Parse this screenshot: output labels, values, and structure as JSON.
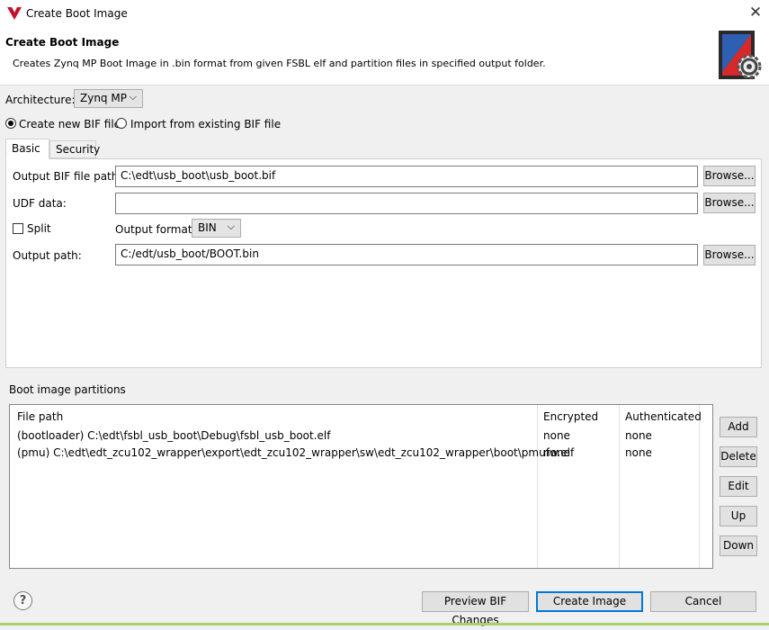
{
  "window": {
    "title": "Create Boot Image",
    "close_glyph": "✕"
  },
  "header": {
    "title": "Create Boot Image",
    "description": "Creates Zynq MP Boot Image in .bin format from given FSBL elf and partition files in specified output folder."
  },
  "architecture": {
    "label": "Architecture:",
    "value": "Zynq MP"
  },
  "bif_mode": {
    "create_label": "Create new BIF file",
    "import_label": "Import from existing BIF file",
    "selected": "create"
  },
  "tabs": [
    {
      "label": "Basic",
      "active": true
    },
    {
      "label": "Security",
      "active": false
    }
  ],
  "basic": {
    "output_bif_label": "Output BIF file path:",
    "output_bif_value": "C:\\edt\\usb_boot\\usb_boot.bif",
    "udf_label": "UDF data:",
    "udf_value": "",
    "split_label": "Split",
    "split_checked": false,
    "output_format_label": "Output format:",
    "output_format_value": "BIN",
    "output_path_label": "Output path:",
    "output_path_value": "C:/edt/usb_boot/BOOT.bin",
    "browse_label": "Browse..."
  },
  "partitions": {
    "section_label": "Boot image partitions",
    "columns": [
      "File path",
      "Encrypted",
      "Authenticated"
    ],
    "rows": [
      {
        "path": "(bootloader) C:\\edt\\fsbl_usb_boot\\Debug\\fsbl_usb_boot.elf",
        "encrypted": "none",
        "authenticated": "none"
      },
      {
        "path": "(pmu) C:\\edt\\edt_zcu102_wrapper\\export\\edt_zcu102_wrapper\\sw\\edt_zcu102_wrapper\\boot\\pmufw.elf",
        "encrypted": "none",
        "authenticated": "none"
      }
    ],
    "buttons": {
      "add": "Add",
      "delete": "Delete",
      "edit": "Edit",
      "up": "Up",
      "down": "Down"
    }
  },
  "footer": {
    "help_glyph": "?",
    "preview_label": "Preview BIF Changes",
    "create_label": "Create Image",
    "cancel_label": "Cancel"
  },
  "colors": {
    "primary_border": "#0078d7",
    "panel_bg": "#f0f0f0",
    "logo_red": "#c8102e"
  }
}
